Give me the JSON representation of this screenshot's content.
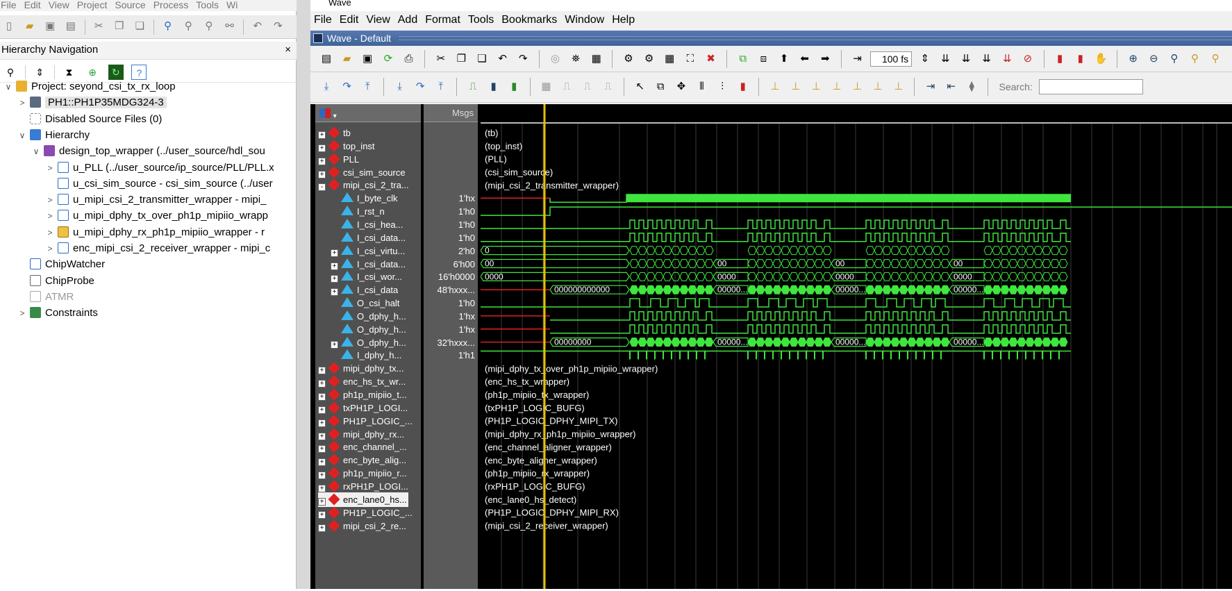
{
  "left_menu": [
    "File",
    "Edit",
    "View",
    "Project",
    "Source",
    "Process",
    "Tools",
    "Wi"
  ],
  "hier_nav": {
    "title": "Hierarchy Navigation",
    "close": "×"
  },
  "tree": [
    {
      "label": "Project: seyond_csi_tx_rx_loop",
      "toggle": "∨",
      "icon": "project-icon",
      "level": 0
    },
    {
      "label": "PH1::PH1P35MDG324-3",
      "toggle": ">",
      "icon": "chip-icon",
      "level": 1,
      "selected": true
    },
    {
      "label": "Disabled Source Files (0)",
      "toggle": "",
      "icon": "disabled-files-icon",
      "level": 1
    },
    {
      "label": "Hierarchy",
      "toggle": "∨",
      "icon": "hierarchy-icon",
      "level": 1
    },
    {
      "label": "design_top_wrapper (../user_source/hdl_sou",
      "toggle": "∨",
      "icon": "module-tree-icon",
      "level": 2
    },
    {
      "label": "u_PLL (../user_source/ip_source/PLL/PLL.x",
      "toggle": ">",
      "icon": "ip-icon",
      "level": 3
    },
    {
      "label": "u_csi_sim_source - csi_sim_source (../user",
      "toggle": "",
      "icon": "verilog-file-icon",
      "level": 3
    },
    {
      "label": "u_mipi_csi_2_transmitter_wrapper - mipi_",
      "toggle": ">",
      "icon": "verilog-file-icon",
      "level": 3
    },
    {
      "label": "u_mipi_dphy_tx_over_ph1p_mipiio_wrapp",
      "toggle": ">",
      "icon": "verilog-file-icon",
      "level": 3
    },
    {
      "label": "u_mipi_dphy_rx_ph1p_mipiio_wrapper - r",
      "toggle": ">",
      "icon": "sv-file-icon",
      "level": 3
    },
    {
      "label": "enc_mipi_csi_2_receiver_wrapper - mipi_c",
      "toggle": ">",
      "icon": "verilog-file-icon",
      "level": 3
    },
    {
      "label": "ChipWatcher",
      "toggle": "",
      "icon": "chipwatcher-icon",
      "level": 1
    },
    {
      "label": "ChipProbe",
      "toggle": "",
      "icon": "chipprobe-icon",
      "level": 1
    },
    {
      "label": "ATMR",
      "toggle": "",
      "icon": "atmr-icon",
      "level": 1,
      "disabled": true
    },
    {
      "label": "Constraints",
      "toggle": ">",
      "icon": "constraints-icon",
      "level": 1
    }
  ],
  "wave_title": "Wave",
  "wave_menu": [
    "File",
    "Edit",
    "View",
    "Add",
    "Format",
    "Tools",
    "Bookmarks",
    "Window",
    "Help"
  ],
  "wave_default": "Wave - Default",
  "toolbar": {
    "time_value": "100 fs",
    "search_label": "Search:",
    "search_value": ""
  },
  "msgs_header": "Msgs",
  "signals": [
    {
      "name": "tb",
      "value": "",
      "pm": "+",
      "kind": "inst",
      "wave": "(tb)",
      "indent": 0
    },
    {
      "name": "top_inst",
      "value": "",
      "pm": "+",
      "kind": "inst",
      "wave": "(top_inst)",
      "indent": 0
    },
    {
      "name": "PLL",
      "value": "",
      "pm": "+",
      "kind": "inst",
      "wave": "(PLL)",
      "indent": 0
    },
    {
      "name": "csi_sim_source",
      "value": "",
      "pm": "+",
      "kind": "inst",
      "wave": "(csi_sim_source)",
      "indent": 0
    },
    {
      "name": "mipi_csi_2_tra...",
      "value": "",
      "pm": "-",
      "kind": "inst",
      "wave": "(mipi_csi_2_transmitter_wrapper)",
      "indent": 0
    },
    {
      "name": "I_byte_clk",
      "value": "1'hx",
      "pm": "",
      "kind": "sig",
      "wave": "",
      "indent": 1
    },
    {
      "name": "I_rst_n",
      "value": "1'h0",
      "pm": "",
      "kind": "sig",
      "wave": "",
      "indent": 1
    },
    {
      "name": "I_csi_hea...",
      "value": "1'h0",
      "pm": "",
      "kind": "sig",
      "wave": "",
      "indent": 1
    },
    {
      "name": "I_csi_data...",
      "value": "1'h0",
      "pm": "",
      "kind": "sig",
      "wave": "",
      "indent": 1
    },
    {
      "name": "I_csi_virtu...",
      "value": "2'h0",
      "pm": "+",
      "kind": "sig",
      "wave": "0",
      "indent": 1
    },
    {
      "name": "I_csi_data...",
      "value": "6'h00",
      "pm": "+",
      "kind": "sig",
      "wave": "00",
      "indent": 1
    },
    {
      "name": "I_csi_wor...",
      "value": "16'h0000",
      "pm": "+",
      "kind": "sig",
      "wave": "0000",
      "indent": 1
    },
    {
      "name": "I_csi_data",
      "value": "48'hxxx...",
      "pm": "+",
      "kind": "sig",
      "wave": "000000000000",
      "indent": 1
    },
    {
      "name": "O_csi_halt",
      "value": "1'h0",
      "pm": "",
      "kind": "sig",
      "wave": "",
      "indent": 1
    },
    {
      "name": "O_dphy_h...",
      "value": "1'hx",
      "pm": "",
      "kind": "sig",
      "wave": "",
      "indent": 1
    },
    {
      "name": "O_dphy_h...",
      "value": "1'hx",
      "pm": "",
      "kind": "sig",
      "wave": "",
      "indent": 1
    },
    {
      "name": "O_dphy_h...",
      "value": "32'hxxx...",
      "pm": "+",
      "kind": "sig",
      "wave": "00000000",
      "indent": 1
    },
    {
      "name": "I_dphy_h...",
      "value": "1'h1",
      "pm": "",
      "kind": "sig",
      "wave": "",
      "indent": 1
    },
    {
      "name": "mipi_dphy_tx...",
      "value": "",
      "pm": "+",
      "kind": "inst",
      "wave": "(mipi_dphy_tx_over_ph1p_mipiio_wrapper)",
      "indent": 0
    },
    {
      "name": "enc_hs_tx_wr...",
      "value": "",
      "pm": "+",
      "kind": "inst",
      "wave": "(enc_hs_tx_wrapper)",
      "indent": 0
    },
    {
      "name": "ph1p_mipiio_t...",
      "value": "",
      "pm": "+",
      "kind": "inst",
      "wave": "(ph1p_mipiio_tx_wrapper)",
      "indent": 0
    },
    {
      "name": "txPH1P_LOGI...",
      "value": "",
      "pm": "+",
      "kind": "inst",
      "wave": "(txPH1P_LOGIC_BUFG)",
      "indent": 0
    },
    {
      "name": "PH1P_LOGIC_...",
      "value": "",
      "pm": "+",
      "kind": "inst",
      "wave": "(PH1P_LOGIC_DPHY_MIPI_TX)",
      "indent": 0
    },
    {
      "name": "mipi_dphy_rx...",
      "value": "",
      "pm": "+",
      "kind": "inst",
      "wave": "(mipi_dphy_rx_ph1p_mipiio_wrapper)",
      "indent": 0
    },
    {
      "name": "enc_channel_...",
      "value": "",
      "pm": "+",
      "kind": "inst",
      "wave": "(enc_channel_aligner_wrapper)",
      "indent": 0
    },
    {
      "name": "enc_byte_alig...",
      "value": "",
      "pm": "+",
      "kind": "inst",
      "wave": "(enc_byte_aligner_wrapper)",
      "indent": 0
    },
    {
      "name": "ph1p_mipiio_r...",
      "value": "",
      "pm": "+",
      "kind": "inst",
      "wave": "(ph1p_mipiio_rx_wrapper)",
      "indent": 0
    },
    {
      "name": "rxPH1P_LOGI...",
      "value": "",
      "pm": "+",
      "kind": "inst",
      "wave": "(rxPH1P_LOGIC_BUFG)",
      "indent": 0
    },
    {
      "name": "enc_lane0_hs...",
      "value": "",
      "pm": "+",
      "kind": "inst",
      "wave": "(enc_lane0_hs_detect)",
      "indent": 0,
      "selected": true
    },
    {
      "name": "PH1P_LOGIC_...",
      "value": "",
      "pm": "+",
      "kind": "inst",
      "wave": "(PH1P_LOGIC_DPHY_MIPI_RX)",
      "indent": 0
    },
    {
      "name": "mipi_csi_2_re...",
      "value": "",
      "pm": "+",
      "kind": "inst",
      "wave": "(mipi_csi_2_receiver_wrapper)",
      "indent": 0
    }
  ],
  "bus_labels": {
    "vc": [
      "0",
      "0",
      "0",
      "0",
      "0",
      "0",
      "0",
      "0",
      "0",
      "0",
      "0",
      "0"
    ],
    "dt": [
      "00",
      "00",
      "00"
    ],
    "wc": [
      "0000",
      "0000",
      "0000"
    ],
    "data": [
      "00000...",
      "00000...",
      "00000..."
    ],
    "odata": [
      "00000...",
      "00000...",
      "00000..."
    ]
  },
  "colors": {
    "wave": "#3ee63e",
    "wave_dim": "#5cff5c",
    "cursor": "#e8c000",
    "unknown": "#e02020",
    "gridline": "#3a3a3a"
  }
}
